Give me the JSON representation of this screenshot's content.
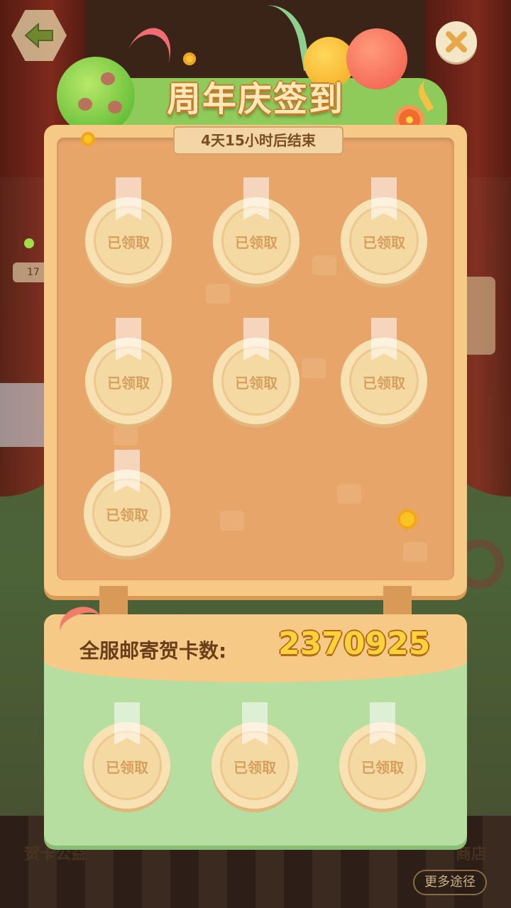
{
  "title": "周年庆签到",
  "timer": "4天15小时后结束",
  "claimed_label": "已领取",
  "board_rewards": [
    {
      "status": "已领取"
    },
    {
      "status": "已领取"
    },
    {
      "status": "已领取"
    },
    {
      "status": "已领取"
    },
    {
      "status": "已领取"
    },
    {
      "status": "已领取"
    },
    {
      "status": "已领取"
    }
  ],
  "cards_panel": {
    "label": "全服邮寄贺卡数:",
    "count": "2370925",
    "rewards": [
      {
        "status": "已领取"
      },
      {
        "status": "已领取"
      },
      {
        "status": "已领取"
      }
    ]
  },
  "background": {
    "left_counter": "17",
    "left_bottom_label": "贺卡公益",
    "right_bottom_label": "商店",
    "more_button": "更多途径"
  },
  "colors": {
    "board": "#f6c987",
    "board_inner": "#e8a56a",
    "panel_green": "#b6dea0",
    "count_yellow": "#ffd23c"
  },
  "icons": [
    "back-arrow-icon",
    "close-x-icon"
  ]
}
